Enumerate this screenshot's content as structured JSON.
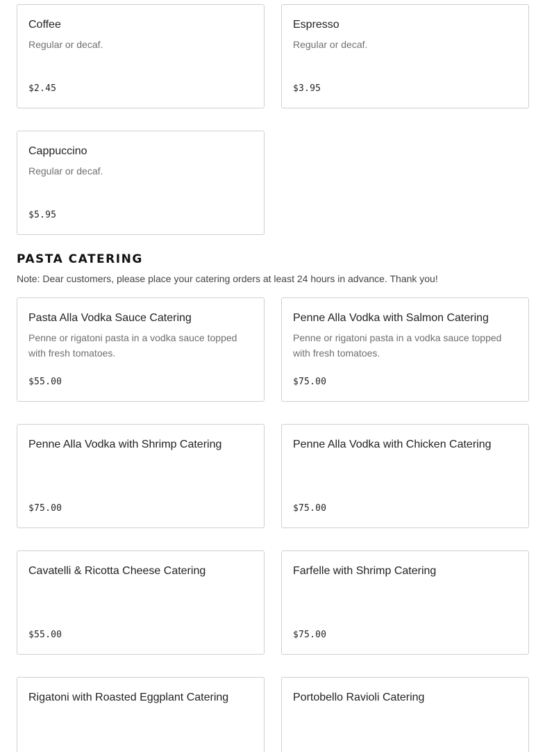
{
  "coffee_items": [
    {
      "name": "Coffee",
      "description": "Regular or decaf.",
      "price": "$2.45"
    },
    {
      "name": "Espresso",
      "description": "Regular or decaf.",
      "price": "$3.95"
    },
    {
      "name": "Cappuccino",
      "description": "Regular or decaf.",
      "price": "$5.95"
    }
  ],
  "pasta_section": {
    "title": "PASTA CATERING",
    "note": "Note: Dear customers, please place your catering orders at least 24 hours in advance. Thank you!",
    "items": [
      {
        "name": "Pasta Alla Vodka Sauce Catering",
        "description": "Penne or rigatoni pasta in a vodka sauce topped with fresh tomatoes.",
        "price": "$55.00"
      },
      {
        "name": "Penne Alla Vodka with Salmon Catering",
        "description": "Penne or rigatoni pasta in a vodka sauce topped with fresh tomatoes.",
        "price": "$75.00"
      },
      {
        "name": "Penne Alla Vodka with Shrimp Catering",
        "description": "",
        "price": "$75.00"
      },
      {
        "name": "Penne Alla Vodka with Chicken Catering",
        "description": "",
        "price": "$75.00"
      },
      {
        "name": "Cavatelli & Ricotta Cheese Catering",
        "description": "",
        "price": "$55.00"
      },
      {
        "name": "Farfelle with Shrimp Catering",
        "description": "",
        "price": "$75.00"
      },
      {
        "name": "Rigatoni with Roasted Eggplant Catering",
        "description": "",
        "price": "",
        "partially_visible": true
      },
      {
        "name": "Portobello Ravioli Catering",
        "description": "",
        "price": "",
        "partially_visible": true
      }
    ]
  }
}
